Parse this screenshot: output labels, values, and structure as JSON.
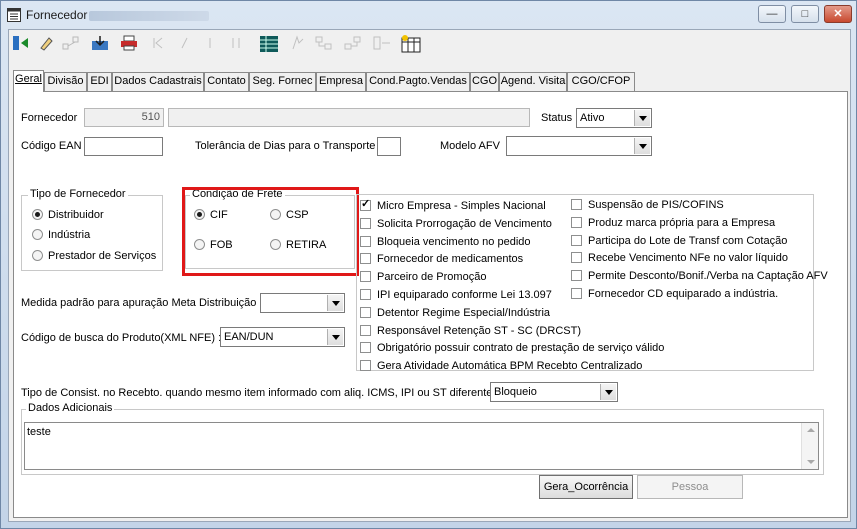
{
  "window": {
    "title": "Fornecedor"
  },
  "toolbar": {
    "buttons": [
      "exit-icon",
      "edit-icon",
      "flow-icon",
      "save-icon",
      "print-icon",
      "first-icon",
      "prev-icon",
      "next-icon",
      "last-icon",
      "grid-icon",
      "query-icon",
      "tree-icon",
      "branch-icon",
      "split-icon",
      "table-columns-icon"
    ]
  },
  "tabs": [
    "Geral",
    "Divisão",
    "EDI",
    "Dados Cadastrais",
    "Contato",
    "Seg. Fornec",
    "Empresa",
    "Cond.Pagto.Vendas",
    "CGO",
    "Agend. Visita",
    "CGO/CFOP"
  ],
  "form": {
    "fornecedor_label": "Fornecedor",
    "fornecedor_code": "510",
    "status_label": "Status",
    "status_value": "Ativo",
    "codigo_ean_label": "Código EAN",
    "tolerancia_label": "Tolerância de Dias para o Transporte",
    "modelo_afv_label": "Modelo AFV",
    "tipo_fornecedor": {
      "title": "Tipo de Fornecedor",
      "options": [
        "Distribuidor",
        "Indústria",
        "Prestador de Serviços"
      ],
      "selected": 0
    },
    "condicao_frete": {
      "title": "Condição de Frete",
      "options": [
        "CIF",
        "CSP",
        "FOB",
        "RETIRA"
      ],
      "selected": 0
    },
    "checks_left": [
      {
        "label": "Micro Empresa - Simples Nacional",
        "checked": true
      },
      {
        "label": "Solicita Prorrogação de Vencimento",
        "checked": false
      },
      {
        "label": "Bloqueia vencimento no pedido",
        "checked": false
      },
      {
        "label": "Fornecedor de medicamentos",
        "checked": false
      },
      {
        "label": "Parceiro de Promoção",
        "checked": false
      },
      {
        "label": "IPI equiparado conforme Lei 13.097",
        "checked": false
      },
      {
        "label": "Detentor Regime Especial/Indústria",
        "checked": false
      },
      {
        "label": "Responsável Retenção ST - SC (DRCST)",
        "checked": false
      },
      {
        "label": "Obrigatório possuir contrato de prestação de serviço válido",
        "checked": false
      },
      {
        "label": "Gera Atividade Automática BPM Recebto Centralizado",
        "checked": false
      }
    ],
    "checks_right": [
      {
        "label": "Suspensão de PIS/COFINS",
        "checked": false
      },
      {
        "label": "Produz marca própria para a Empresa",
        "checked": false
      },
      {
        "label": "Participa do Lote de Transf com Cotação",
        "checked": false
      },
      {
        "label": "Recebe Vencimento NFe no valor líquido",
        "checked": false
      },
      {
        "label": "Permite Desconto/Bonif./Verba na Captação AFV",
        "checked": false
      },
      {
        "label": "Fornecedor CD equiparado a indústria.",
        "checked": false
      }
    ],
    "medida_label": "Medida padrão para apuração Meta Distribuição",
    "codigo_busca_label": "Código de busca do Produto(XML NFE) :",
    "codigo_busca_value": "EAN/DUN",
    "tipo_consist_label": "Tipo de Consist. no Recebto. quando mesmo item informado com aliq. ICMS, IPI ou ST diferentes:",
    "tipo_consist_value": "Bloqueio",
    "dados_adicionais_title": "Dados Adicionais",
    "dados_adicionais_text": "teste"
  },
  "buttons": {
    "gera_ocorrencia": "Gera_Ocorrência",
    "pessoa": "Pessoa"
  },
  "colors": {
    "highlight": "#e01818",
    "window_bg": "#c5d6ea"
  }
}
